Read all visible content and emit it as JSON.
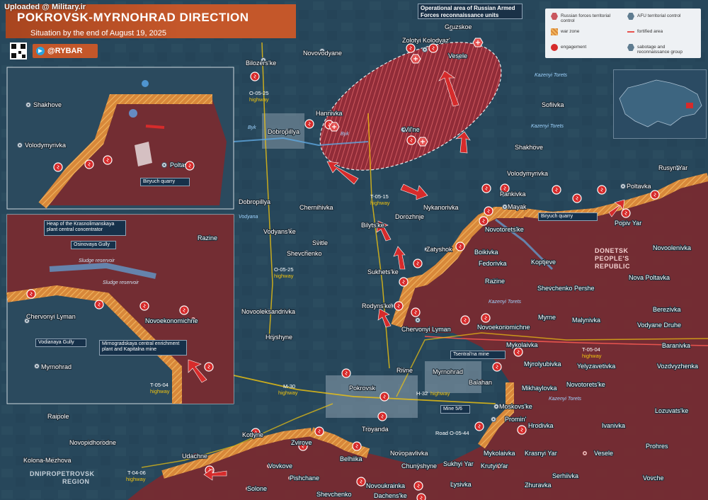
{
  "watermark": "Uploaded @ Military.ir",
  "title": {
    "main": "POKROVSK-MYRNOHRAD DIRECTION",
    "subtitle": "Situation by the end of August 19, 2025"
  },
  "brand": {
    "handle": "@RYBAR",
    "icons": [
      "qr-code-icon",
      "telegram-icon"
    ]
  },
  "colors": {
    "russian_control": "#7a2a30",
    "afu_control": "#2a4a5e",
    "war_zone": "#d98a3a",
    "engagement": "#d62b2b",
    "fortified_area": "#e8544f",
    "operational_area": "#b0303a",
    "title_bar": "#c4572a",
    "highway_label": "#f1c40f"
  },
  "legend": {
    "items": [
      {
        "label": "Russian forces territorial control",
        "icon": "russian-control-swatch"
      },
      {
        "label": "AFU territorial control",
        "icon": "afu-control-swatch"
      },
      {
        "label": "war zone",
        "icon": "war-zone-swatch"
      },
      {
        "label": "fortified area",
        "icon": "fortified-area-line"
      },
      {
        "label": "engagement",
        "icon": "engagement-icon"
      },
      {
        "label": "sabotage and reconnaissance group",
        "icon": "sabotage-group-icon"
      }
    ]
  },
  "operational_note": "Operational area of Russian Armed Forces reconnaissance units",
  "regions": {
    "donetsk": [
      "DONETSK",
      "PEOPLE'S",
      "REPUBLIC"
    ],
    "dnipropetrovsk": [
      "DNIPROPETROVSK",
      "REGION"
    ]
  },
  "rivers": [
    "Byk",
    "Byk",
    "Vodyana",
    "Kazenyi Torets",
    "Kazenyi Torets",
    "Kazenyi Torets",
    "Kazenyi Torets"
  ],
  "highways": [
    {
      "code": "O-05-25",
      "label": "highway"
    },
    {
      "code": "T-05-15",
      "label": "highway"
    },
    {
      "code": "O-05-25",
      "label": "highway"
    },
    {
      "code": "M-30",
      "label": "highway"
    },
    {
      "code": "H-32",
      "label": "highway"
    },
    {
      "code": "T-04-06",
      "label": "highway"
    },
    {
      "code": "T-05-04",
      "label": "highway"
    },
    {
      "code": "Road O-05-44",
      "label": ""
    }
  ],
  "callouts": {
    "biryuch_quarry": "Biryuch quarry",
    "tsentralna_mine": "Tsentral'na mine",
    "mine_5_6": "Mine 5/6"
  },
  "settlements": [
    "Bilozers'ke",
    "Novovodyane",
    "Gruzskoe",
    "Zolotyi Kolodyaz'",
    "Vesele",
    "Hannivka",
    "Dobropillya",
    "Vil'ne",
    "Sofiivka",
    "Shakhove",
    "Volodymyrivka",
    "Rusyn Yar",
    "Poltavka",
    "Popiv Yar",
    "Pankivka",
    "Mayak",
    "Nykanorivka",
    "Novotorets'ke",
    "Dorozhnje",
    "Bilyts'ke",
    "Chernihivka",
    "Vodyans'ke",
    "Svitle",
    "Shevchenko",
    "Dobropillya",
    "Zatyshok",
    "Boikivka",
    "Fedorivka",
    "Novoolenivka",
    "Koptjeve",
    "Sukhets'ke",
    "Razine",
    "Shevchenko Pershe",
    "Nova Poltavka",
    "Rodyns'ke",
    "Chervonyi Lyman",
    "Novoekonomichne",
    "Myrne",
    "Malynivka",
    "Berezivka",
    "Vodyane Druhe",
    "Baranivka",
    "Mykolaivka",
    "Novooleksandrivka",
    "Hryshyne",
    "Myrolyubivka",
    "Yelyzavetivka",
    "Vozdvyzhenka",
    "Rivne",
    "Myrnohrad",
    "Balahan",
    "Mikhaylovka",
    "Novotorets'ke",
    "Pokrovsk",
    "Moskovs'ke",
    "Promin'",
    "Troyanda",
    "Hrodivka",
    "Ivanivka",
    "Lozuvats'ke",
    "Raipole",
    "Novopidhorodne",
    "Kotlyne",
    "Zvirove",
    "Novopavlivka",
    "Mykolaivka",
    "Krasnyi Yar",
    "Vesele",
    "Prohres",
    "Kolona-Mezhova",
    "Udachne",
    "Chunyshyne",
    "Sukhyi Yar",
    "Krutyi Yar",
    "Serhiivka",
    "Vovkove",
    "Belhiika",
    "Zhuravka",
    "Pishchane",
    "Lysivka",
    "Vovche",
    "Solone",
    "Shevchenko",
    "Novoukrainka",
    "Dachens'ke"
  ],
  "inset_top": {
    "settlements": [
      "Shakhove",
      "Volodymyrivka",
      "Poltavka"
    ],
    "callout": "Biryuch quarry"
  },
  "inset_bottom": {
    "settlements": [
      "Razine",
      "Chervonyi Lyman",
      "Novoekonomichne",
      "Myrnohrad"
    ],
    "labels": {
      "heap": "Heap of the Krasnolimanskaya plant central concentrator",
      "osinovaya": "Osinovaya Gully",
      "sludge1": "Sludge reservoir",
      "sludge2": "Sludge reservoir",
      "vodianaya": "Vodianaya Gully",
      "mine": "Mirnogradskaya central enrichment plant and Kapitalna mine"
    },
    "highway": {
      "code": "T-05-04",
      "label": "highway"
    }
  }
}
